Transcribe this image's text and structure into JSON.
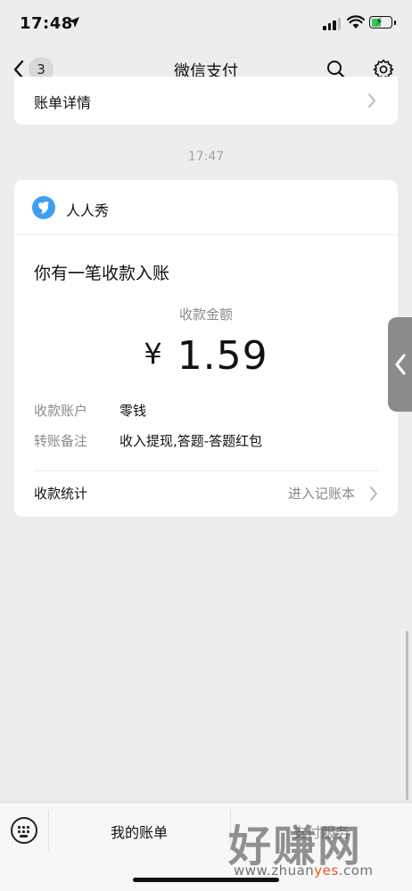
{
  "status_bar": {
    "time": "17:48"
  },
  "nav": {
    "back_count": "3",
    "title": "微信支付"
  },
  "previous_card": {
    "label": "账单详情"
  },
  "timestamp": "17:47",
  "message": {
    "app_name": "人人秀",
    "title": "你有一笔收款入账",
    "amount_label": "收款金额",
    "currency": "¥",
    "amount": "1.59",
    "rows": [
      {
        "label": "收款账户",
        "value": "零钱"
      },
      {
        "label": "转账备注",
        "value": "收入提现,答题-答题红包"
      }
    ],
    "stats_label": "收款统计",
    "stats_link": "进入记账本"
  },
  "bottom_bar": {
    "my_bills": "我的账单",
    "right_tab": "支付服务"
  },
  "watermark": {
    "big": "好赚网",
    "small_pre": "www.zhuan",
    "small_hl": "yes",
    "small_post": ".com"
  },
  "colors": {
    "accent_battery": "#35c759",
    "app_icon": "#3ea0f0",
    "background": "#ededed"
  }
}
